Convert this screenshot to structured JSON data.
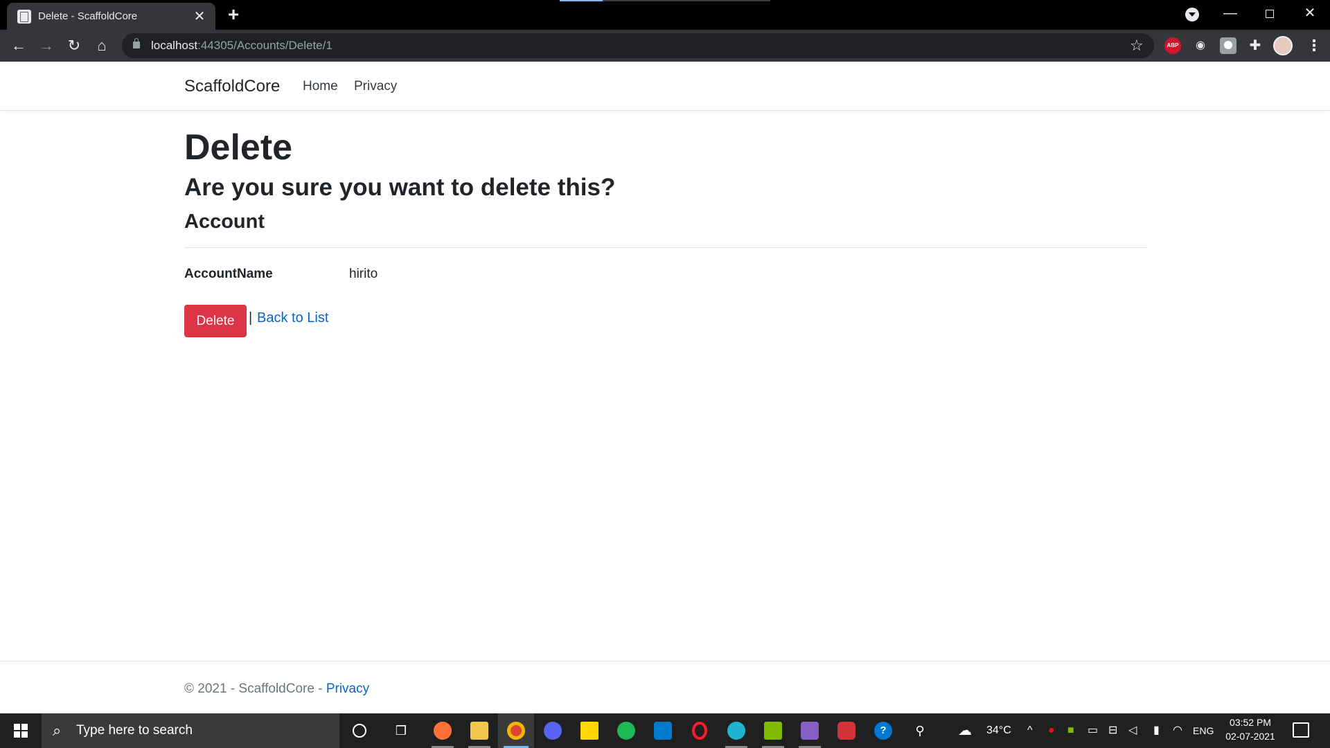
{
  "browser": {
    "tab_title": "Delete - ScaffoldCore",
    "tab_close": "✕",
    "new_tab": "+",
    "url_host": "localhost",
    "url_path": ":44305/Accounts/Delete/1",
    "extensions": {
      "abp": "ABP"
    }
  },
  "site": {
    "brand": "ScaffoldCore",
    "nav": {
      "home": "Home",
      "privacy": "Privacy"
    }
  },
  "main": {
    "heading": "Delete",
    "confirm": "Are you sure you want to delete this?",
    "entity": "Account",
    "fields": [
      {
        "label": "AccountName",
        "value": "hirito"
      }
    ],
    "delete_button": "Delete",
    "separator": "|",
    "back_link": "Back to List"
  },
  "footer": {
    "text": "© 2021 - ScaffoldCore - ",
    "link": "Privacy"
  },
  "taskbar": {
    "search_placeholder": "Type here to search",
    "weather": "34°C",
    "language": "ENG",
    "time": "03:52 PM",
    "date": "02-07-2021"
  },
  "colors": {
    "danger": "#dc3545",
    "link": "#0366d6",
    "chrome_dark": "#35363a",
    "taskbar": "#202020"
  }
}
